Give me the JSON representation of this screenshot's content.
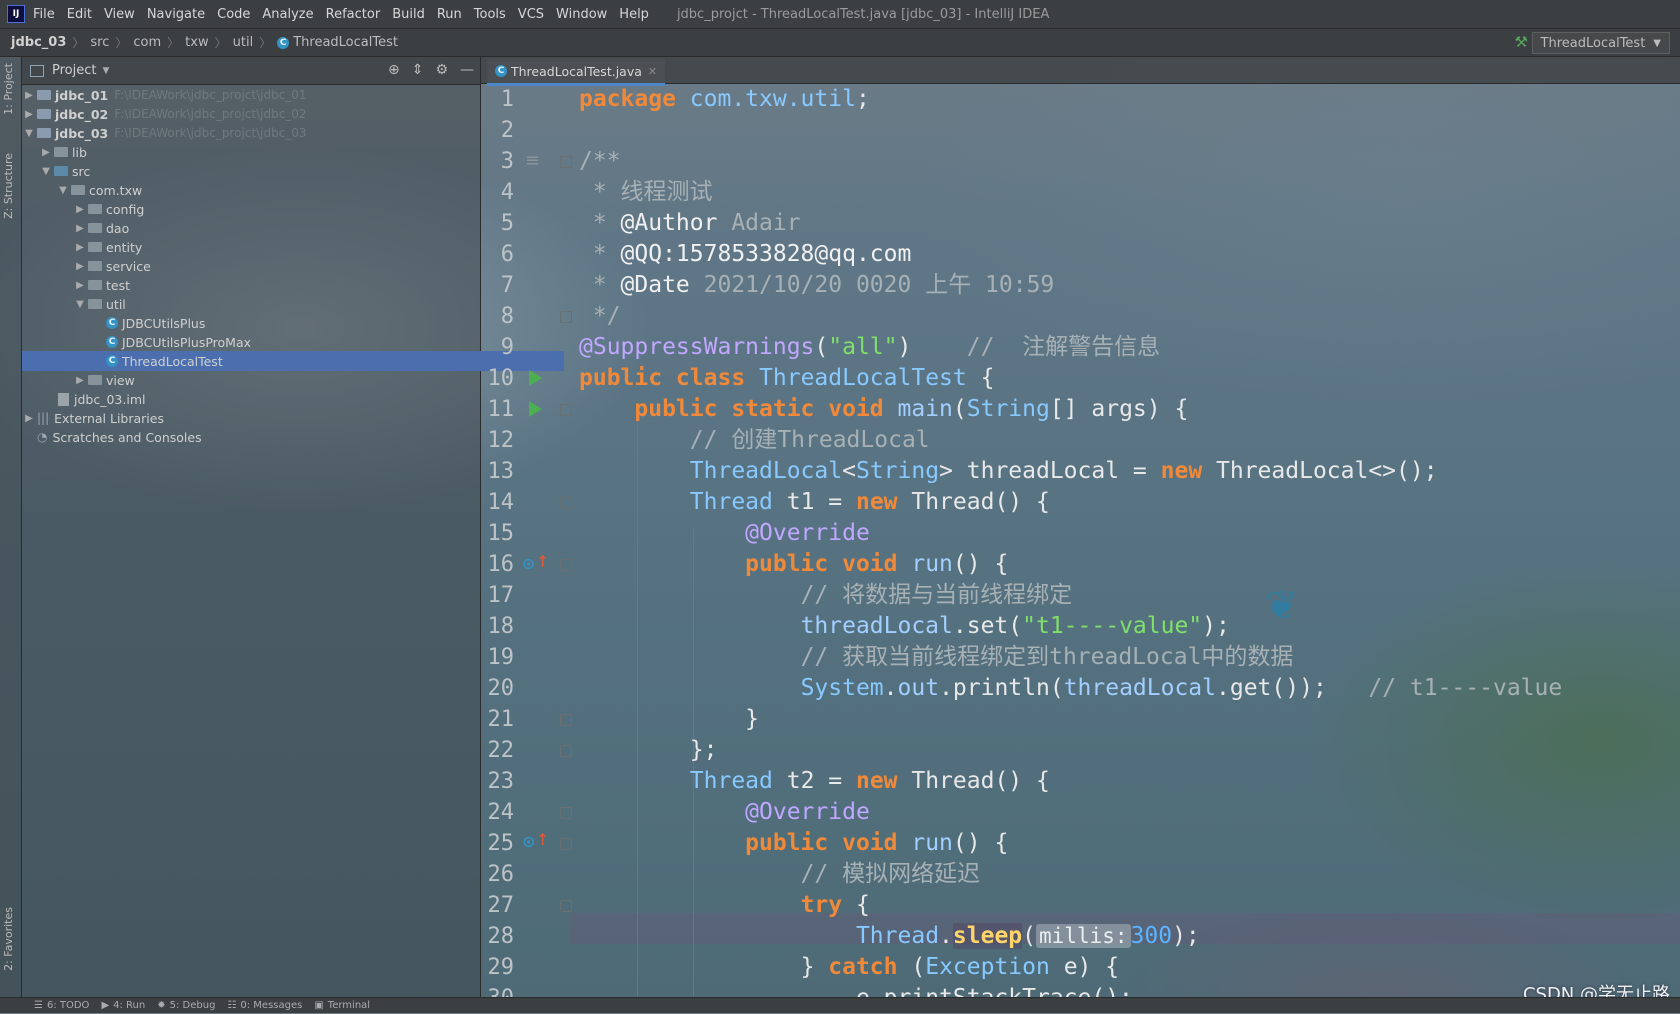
{
  "menubar": {
    "items": [
      "File",
      "Edit",
      "View",
      "Navigate",
      "Code",
      "Analyze",
      "Refactor",
      "Build",
      "Run",
      "Tools",
      "VCS",
      "Window",
      "Help"
    ],
    "window_title": "jdbc_projct - ThreadLocalTest.java [jdbc_03] - IntelliJ IDEA"
  },
  "breadcrumb": [
    "jdbc_03",
    "src",
    "com",
    "txw",
    "util",
    "ThreadLocalTest"
  ],
  "run_config": "ThreadLocalTest",
  "tool_strip": {
    "project_tab": "1: Project",
    "structure_tab": "Z: Structure",
    "favorites_tab": "2: Favorites"
  },
  "project_panel": {
    "title": "Project",
    "tree": [
      {
        "label": "jdbc_01",
        "path": "F:\\IDEAWork\\jdbc_projct\\jdbc_01",
        "expanded": false,
        "bold": true
      },
      {
        "label": "jdbc_02",
        "path": "F:\\IDEAWork\\jdbc_projct\\jdbc_02",
        "expanded": false,
        "bold": true
      },
      {
        "label": "jdbc_03",
        "path": "F:\\IDEAWork\\jdbc_projct\\jdbc_03",
        "expanded": true,
        "bold": true
      },
      {
        "label": "lib"
      },
      {
        "label": "src"
      },
      {
        "label": "com.txw"
      },
      {
        "label": "config"
      },
      {
        "label": "dao"
      },
      {
        "label": "entity"
      },
      {
        "label": "service"
      },
      {
        "label": "test"
      },
      {
        "label": "util"
      },
      {
        "label": "JDBCUtilsPlus"
      },
      {
        "label": "JDBCUtilsPlusProMax"
      },
      {
        "label": "ThreadLocalTest",
        "selected": true
      },
      {
        "label": "view"
      },
      {
        "label": "jdbc_03.iml"
      },
      {
        "label": "External Libraries"
      },
      {
        "label": "Scratches and Consoles"
      }
    ]
  },
  "editor": {
    "tab_label": "ThreadLocalTest.java",
    "line_numbers": [
      "1",
      "2",
      "3",
      "4",
      "5",
      "6",
      "7",
      "8",
      "9",
      "10",
      "11",
      "12",
      "13",
      "14",
      "15",
      "16",
      "17",
      "18",
      "19",
      "20",
      "21",
      "22",
      "23",
      "24",
      "25",
      "26",
      "27",
      "28",
      "29",
      "30"
    ],
    "code": {
      "l1_kw": "package",
      "l1_pkg": " com.txw.util",
      "l3": "/**",
      "l4_star": " * ",
      "l4_text": "线程测试",
      "l5_star": " * ",
      "l5_tag": "@Author",
      "l5_val": " Adair",
      "l6_star": " * ",
      "l6_tag": "@QQ:1578533828@qq.com",
      "l7_star": " * ",
      "l7_tag": "@Date",
      "l7_val": " 2021/10/20 0020 上午 10:59",
      "l8": " */",
      "l9_ann": "@SuppressWarnings",
      "l9_str": "\"all\"",
      "l9_com": "//  注解警告信息",
      "l10_kw": "public class",
      "l10_cls": "ThreadLocalTest",
      "l11_kw": "public static void",
      "l11_mth": "main",
      "l11_cls": "String",
      "l11_rest": "[] args) {",
      "l12_com": "// 创建ThreadLocal",
      "l13_cls1": "ThreadLocal",
      "l13_cls2": "String",
      "l13_mid": "> threadLocal = ",
      "l13_kw": "new",
      "l13_rest": " ThreadLocal<>();",
      "l14_cls": "Thread",
      "l14_mid": " t1 = ",
      "l14_kw": "new",
      "l14_rest": " Thread() {",
      "l15_ann": "@Override",
      "l16_kw": "public void",
      "l16_mth": "run",
      "l16_rest": "() {",
      "l17_com": "// 将数据与当前线程绑定",
      "l18_fld": "threadLocal",
      "l18_mid": ".set(",
      "l18_str": "\"t1----value\"",
      "l18_rest": ");",
      "l19_com": "// 获取当前线程绑定到threadLocal中的数据",
      "l20_cls": "System",
      "l20_fld1": "out",
      "l20_mid": ".println(",
      "l20_fld2": "threadLocal",
      "l20_rest": ".get());",
      "l20_com": "// t1----value",
      "l21": "}",
      "l22": "};",
      "l23_cls": "Thread",
      "l23_mid": " t2 = ",
      "l23_kw": "new",
      "l23_rest": " Thread() {",
      "l24_ann": "@Override",
      "l25_kw": "public void",
      "l25_mth": "run",
      "l25_rest": "() {",
      "l26_com": "// 模拟网络延迟",
      "l27_kw": "try",
      "l27_rest": " {",
      "l28_cls": "Thread",
      "l28_mth": "sleep",
      "l28_hint": "millis:",
      "l28_num": "300",
      "l28_rest": ");",
      "l29_pre": "} ",
      "l29_kw": "catch",
      "l29_cls": "Exception",
      "l29_rest": " e) {",
      "l30": "e.printStackTrace();"
    }
  },
  "statusbar": {
    "items": [
      "6: TODO",
      "4: Run",
      "5: Debug",
      "0: Messages",
      "Terminal"
    ]
  },
  "watermark": "CSDN @学无止路",
  "colors": {
    "keyword": "#f08a3a",
    "class": "#88c9ff",
    "string": "#7fe06a",
    "comment": "#a7b1b5",
    "annotation": "#c1a7ff",
    "number": "#5ab4ff",
    "selection": "#4b6eaf"
  }
}
